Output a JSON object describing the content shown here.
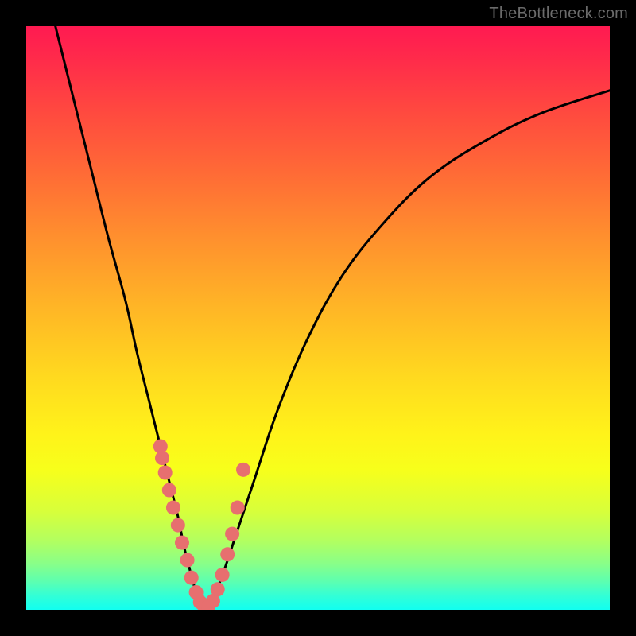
{
  "watermark": "TheBottleneck.com",
  "colors": {
    "frame": "#000000",
    "curve": "#000000",
    "dot": "#e76f6f",
    "gradient_top": "#ff1a51",
    "gradient_mid": "#ffd91f",
    "gradient_bottom": "#11fff0"
  },
  "chart_data": {
    "type": "line",
    "title": "",
    "xlabel": "",
    "ylabel": "",
    "xlim": [
      0,
      100
    ],
    "ylim": [
      0,
      100
    ],
    "grid": false,
    "series": [
      {
        "name": "left-curve",
        "x": [
          5,
          8,
          11,
          14,
          17,
          19,
          21,
          23,
          24.5,
          26,
          27,
          28,
          28.8,
          29.5,
          30
        ],
        "values": [
          100,
          88,
          76,
          64,
          53,
          44,
          36,
          28,
          22,
          16,
          11,
          7,
          4,
          2,
          0.5
        ]
      },
      {
        "name": "right-curve",
        "x": [
          31.5,
          32.5,
          34,
          36,
          39,
          43,
          48,
          54,
          61,
          69,
          78,
          88,
          100
        ],
        "values": [
          0.5,
          3,
          7,
          13,
          22,
          34,
          46,
          57,
          66,
          74,
          80,
          85,
          89
        ]
      }
    ],
    "scatter_points": {
      "name": "data-dots",
      "x": [
        23.0,
        23.3,
        23.8,
        24.5,
        25.2,
        26.0,
        26.7,
        27.6,
        28.3,
        29.1,
        29.8,
        30.5,
        31.2,
        32.0,
        32.8,
        33.6,
        34.5,
        35.3,
        36.2,
        37.2
      ],
      "values": [
        28.0,
        26.0,
        23.5,
        20.5,
        17.5,
        14.5,
        11.5,
        8.5,
        5.5,
        3.0,
        1.3,
        0.6,
        0.6,
        1.5,
        3.5,
        6.0,
        9.5,
        13.0,
        17.5,
        24.0
      ]
    },
    "valley_x": 30.5
  }
}
